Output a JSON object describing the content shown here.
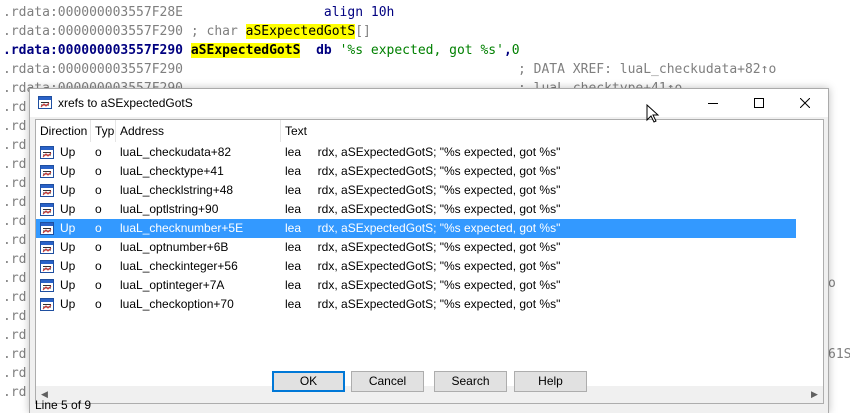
{
  "listing": {
    "line1": {
      "addr": ".rdata:000000003557F28E",
      "mnemonic": "align 10h"
    },
    "line2": {
      "addr": ".rdata:000000003557F290",
      "prefix": "; char ",
      "name": "aSExpectedGotS",
      "suffix": "[]"
    },
    "line3": {
      "addr": ".rdata:000000003557F290",
      "name": "aSExpectedGotS",
      "op": "db ",
      "str": "'%s expected, got %s'",
      "comma": ",",
      "num": "0"
    },
    "line4": {
      "addr": ".rdata:000000003557F290",
      "comment": "; DATA XREF: luaL_checkudata+82↑o"
    },
    "line5": {
      "addr": ".rdata:000000003557F290",
      "comment": "; luaL_checktype+41↑o ..."
    },
    "prefix": ".rd",
    "edge1": "o",
    "edge2": "61S"
  },
  "dialog": {
    "title": "xrefs to aSExpectedGotS",
    "columns": [
      "Direction",
      "Typ",
      "Address",
      "Text"
    ],
    "rows": [
      {
        "dir": "Up",
        "typ": "o",
        "addr": "luaL_checkudata+82",
        "text": "lea     rdx, aSExpectedGotS; \"%s expected, got %s\""
      },
      {
        "dir": "Up",
        "typ": "o",
        "addr": "luaL_checktype+41",
        "text": "lea     rdx, aSExpectedGotS; \"%s expected, got %s\""
      },
      {
        "dir": "Up",
        "typ": "o",
        "addr": "luaL_checklstring+48",
        "text": "lea     rdx, aSExpectedGotS; \"%s expected, got %s\""
      },
      {
        "dir": "Up",
        "typ": "o",
        "addr": "luaL_optlstring+90",
        "text": "lea     rdx, aSExpectedGotS; \"%s expected, got %s\""
      },
      {
        "dir": "Up",
        "typ": "o",
        "addr": "luaL_checknumber+5E",
        "text": "lea     rdx, aSExpectedGotS; \"%s expected, got %s\""
      },
      {
        "dir": "Up",
        "typ": "o",
        "addr": "luaL_optnumber+6B",
        "text": "lea     rdx, aSExpectedGotS; \"%s expected, got %s\""
      },
      {
        "dir": "Up",
        "typ": "o",
        "addr": "luaL_checkinteger+56",
        "text": "lea     rdx, aSExpectedGotS; \"%s expected, got %s\""
      },
      {
        "dir": "Up",
        "typ": "o",
        "addr": "luaL_optinteger+7A",
        "text": "lea     rdx, aSExpectedGotS; \"%s expected, got %s\""
      },
      {
        "dir": "Up",
        "typ": "o",
        "addr": "luaL_checkoption+70",
        "text": "lea     rdx, aSExpectedGotS; \"%s expected, got %s\""
      }
    ],
    "selected_row": 4,
    "buttons": {
      "ok": "OK",
      "cancel": "Cancel",
      "search": "Search",
      "help": "Help"
    },
    "status": "Line 5 of 9"
  },
  "colors": {
    "selection": "#3399ff",
    "highlight": "#ffff00",
    "mnemonic": "#000080",
    "string": "#008000"
  }
}
